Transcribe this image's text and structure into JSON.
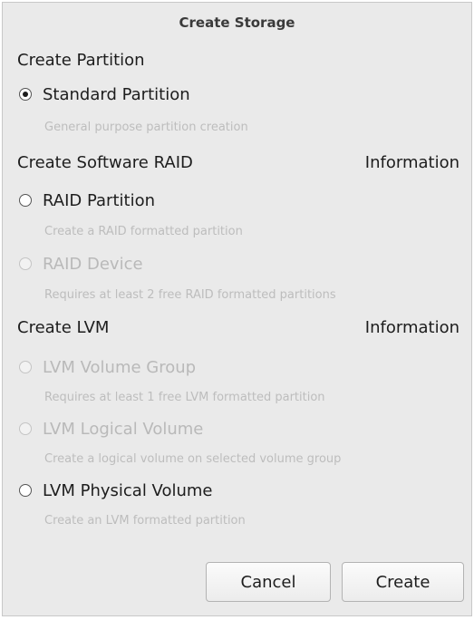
{
  "dialog": {
    "title": "Create Storage"
  },
  "partition": {
    "heading": "Create Partition",
    "standard": {
      "label": "Standard Partition",
      "desc": "General purpose partition creation",
      "selected": true,
      "enabled": true
    }
  },
  "raid": {
    "heading": "Create Software RAID",
    "info": "Information",
    "partition": {
      "label": "RAID Partition",
      "desc": "Create a RAID formatted partition",
      "selected": false,
      "enabled": true
    },
    "device": {
      "label": "RAID Device",
      "desc": "Requires at least 2 free RAID formatted partitions",
      "selected": false,
      "enabled": false
    }
  },
  "lvm": {
    "heading": "Create LVM",
    "info": "Information",
    "volume_group": {
      "label": "LVM Volume Group",
      "desc": "Requires at least 1 free LVM formatted partition",
      "selected": false,
      "enabled": false
    },
    "logical_volume": {
      "label": "LVM Logical Volume",
      "desc": "Create a logical volume on selected volume group",
      "selected": false,
      "enabled": false
    },
    "physical_volume": {
      "label": "LVM Physical Volume",
      "desc": "Create an LVM formatted partition",
      "selected": false,
      "enabled": true
    }
  },
  "buttons": {
    "cancel": "Cancel",
    "create": "Create"
  }
}
